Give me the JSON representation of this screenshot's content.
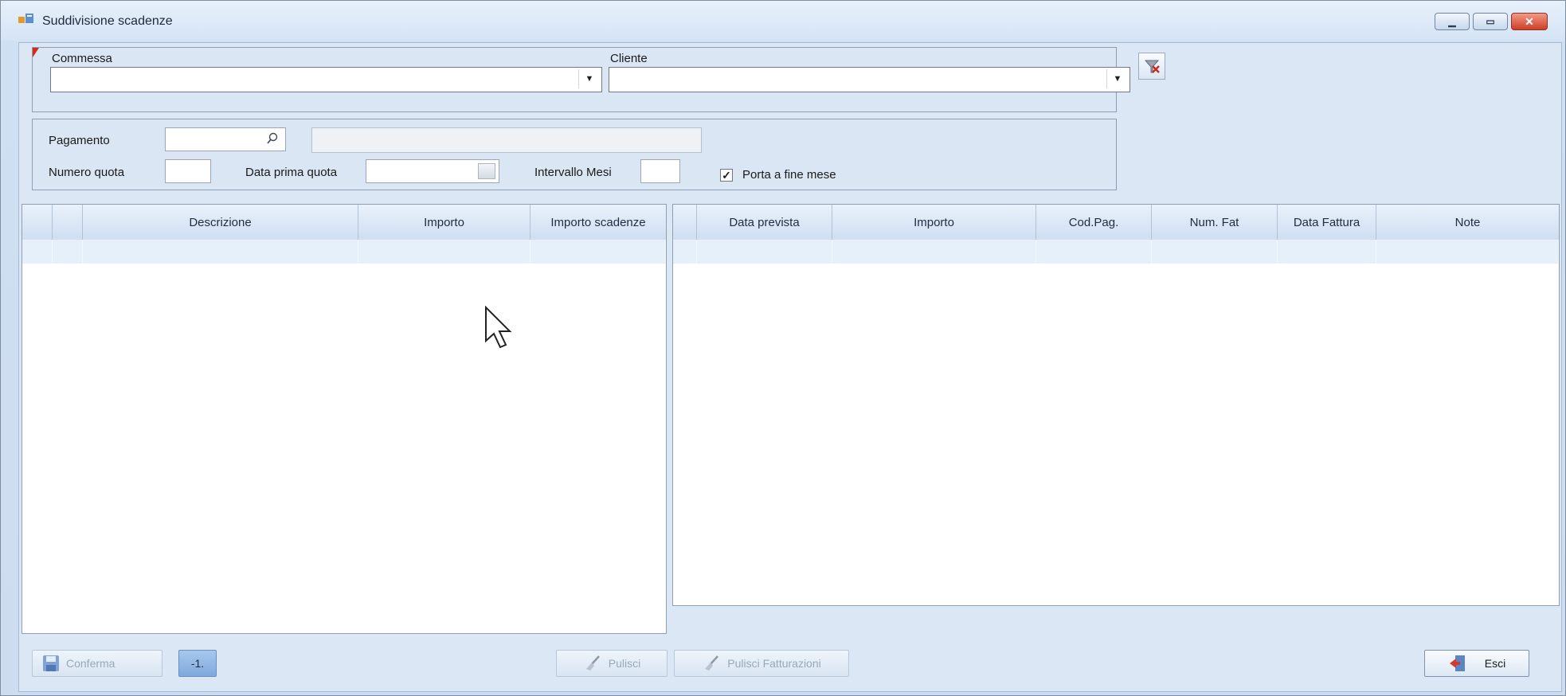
{
  "window": {
    "title": "Suddivisione scadenze"
  },
  "filters": {
    "commessa_label": "Commessa",
    "commessa_value": "",
    "cliente_label": "Cliente",
    "cliente_value": ""
  },
  "payment": {
    "pagamento_label": "Pagamento",
    "pagamento_value": "",
    "pagamento_desc": "",
    "numero_quota_label": "Numero quota",
    "numero_quota_value": "",
    "data_prima_quota_label": "Data prima quota",
    "data_prima_quota_value": "",
    "intervallo_mesi_label": "Intervallo Mesi",
    "intervallo_mesi_value": "",
    "porta_fine_mese_label": "Porta a fine mese",
    "porta_fine_mese_checked": true
  },
  "left_grid": {
    "columns": [
      "Descrizione",
      "Importo",
      "Importo scadenze"
    ]
  },
  "right_grid": {
    "columns": [
      "Data prevista",
      "Importo",
      "Cod.Pag.",
      "Num. Fat",
      "Data Fattura",
      "Note"
    ]
  },
  "toolbar": {
    "conferma_label": "Conferma",
    "minus_one_label": "-1.",
    "pulisci_label": "Pulisci",
    "pulisci_fatturazioni_label": "Pulisci Fatturazioni",
    "esci_label": "Esci"
  },
  "icons": {
    "app": "app-icon",
    "clear_filter": "clear-filter-icon",
    "search": "search-icon",
    "calendar": "calendar-icon",
    "save": "save-icon",
    "broom": "broom-icon",
    "exit": "exit-door-icon"
  }
}
